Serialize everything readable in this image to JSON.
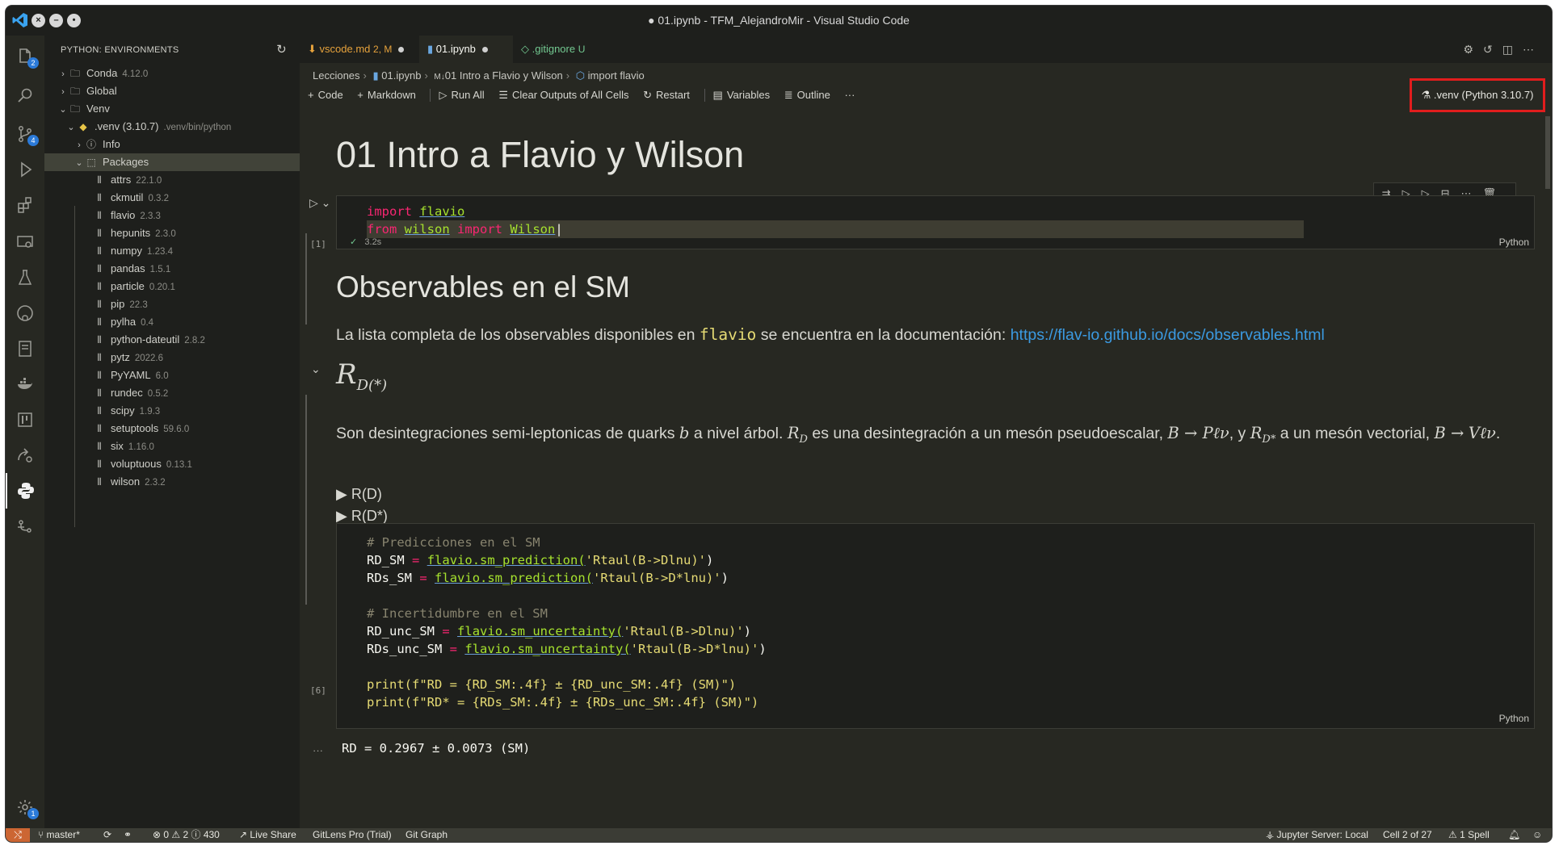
{
  "window": {
    "title": "● 01.ipynb - TFM_AlejandroMir - Visual Studio Code"
  },
  "activity_bar": {
    "explorer_badge": "2",
    "scm_badge": "4",
    "settings_badge": "1"
  },
  "sidebar": {
    "header": "PYTHON: ENVIRONMENTS",
    "groups": [
      {
        "label": "Conda",
        "sub": "4.12.0"
      },
      {
        "label": "Global",
        "sub": ""
      },
      {
        "label": "Venv",
        "sub": ""
      }
    ],
    "venv": {
      "label": ".venv (3.10.7)",
      "sub": ".venv/bin/python"
    },
    "info_label": "Info",
    "packages_label": "Packages",
    "packages": [
      {
        "name": "attrs",
        "version": "22.1.0"
      },
      {
        "name": "ckmutil",
        "version": "0.3.2"
      },
      {
        "name": "flavio",
        "version": "2.3.3"
      },
      {
        "name": "hepunits",
        "version": "2.3.0"
      },
      {
        "name": "numpy",
        "version": "1.23.4"
      },
      {
        "name": "pandas",
        "version": "1.5.1"
      },
      {
        "name": "particle",
        "version": "0.20.1"
      },
      {
        "name": "pip",
        "version": "22.3"
      },
      {
        "name": "pylha",
        "version": "0.4"
      },
      {
        "name": "python-dateutil",
        "version": "2.8.2"
      },
      {
        "name": "pytz",
        "version": "2022.6"
      },
      {
        "name": "PyYAML",
        "version": "6.0"
      },
      {
        "name": "rundec",
        "version": "0.5.2"
      },
      {
        "name": "scipy",
        "version": "1.9.3"
      },
      {
        "name": "setuptools",
        "version": "59.6.0"
      },
      {
        "name": "six",
        "version": "1.16.0"
      },
      {
        "name": "voluptuous",
        "version": "0.13.1"
      },
      {
        "name": "wilson",
        "version": "2.3.2"
      }
    ]
  },
  "tabs": [
    {
      "label": "vscode.md",
      "status": "2, M",
      "color": "#e6a23c"
    },
    {
      "label": "01.ipynb",
      "status": "",
      "color": "#f8f8f2"
    },
    {
      "label": ".gitignore",
      "status": "U",
      "color": "#73c991"
    }
  ],
  "breadcrumb": [
    "Lecciones",
    "01.ipynb",
    "01 Intro a Flavio y Wilson",
    "import flavio"
  ],
  "breadcrumb_prefix": "M↓",
  "toolbar": {
    "code": "Code",
    "markdown": "Markdown",
    "run_all": "Run All",
    "clear_outputs": "Clear Outputs of All Cells",
    "restart": "Restart",
    "variables": "Variables",
    "outline": "Outline",
    "more": "···"
  },
  "kernel": {
    "label": ".venv (Python 3.10.7)"
  },
  "notebook": {
    "title": "01 Intro a Flavio y Wilson",
    "cell1": {
      "exec_count": "[1]",
      "duration": "3.2s",
      "lang": "Python",
      "line1_kw": "import",
      "line1_mod": "flavio",
      "line2_kw1": "from",
      "line2_mod": "wilson",
      "line2_kw2": "import",
      "line2_cls": "Wilson"
    },
    "section_title": "Observables en el SM",
    "intro_text_1": "La lista completa de los observables disponibles en",
    "intro_code": "flavio",
    "intro_text_2": "se encuentra en la documentación:",
    "intro_link": "https://flav-io.github.io/docs/observables.html",
    "rd_heading": "R",
    "rd_heading_sub": "D(*)",
    "rd_text": {
      "p1": "Son desintegraciones semi-leptonicas de quarks",
      "b": "b",
      "p2": "a nivel árbol.",
      "rd": "R",
      "rd_sub": "D",
      "p3": "es una desintegración a un mesón pseudoescalar,",
      "decay1": "B → Pℓν",
      "p4": ", y",
      "rds": "R",
      "rds_sub": "D*",
      "p5": "a un mesón vectorial,",
      "decay2a": "B →",
      "decay2b": "Vℓν",
      "p6": "."
    },
    "details": [
      "R(D)",
      "R(D*)"
    ],
    "cell2": {
      "exec_count": "[6]",
      "lang": "Python",
      "comment1": "# Predicciones en el SM",
      "rd_sm_var": "RD_SM",
      "rd_sm_call": "flavio.sm_prediction(",
      "rd_sm_arg": "'Rtaul(B->Dlnu)'",
      "rds_sm_var": "RDs_SM",
      "rds_sm_arg": "'Rtaul(B->D*lnu)'",
      "comment2": "# Incertidumbre en el SM",
      "rd_unc_var": "RD_unc_SM",
      "unc_call": "flavio.sm_uncertainty(",
      "rds_unc_var": "RDs_unc_SM",
      "print1": "print(f\"RD = {RD_SM:.4f} ± {RD_unc_SM:.4f} (SM)\")",
      "print2": "print(f\"RD* = {RDs_SM:.4f} ± {RDs_unc_SM:.4f} (SM)\")"
    },
    "output_first_line": "RD = 0.2967 ± 0.0073 (SM)"
  },
  "statusbar": {
    "branch": "master*",
    "problems": "⊗ 0 ⚠ 2 ⓘ 430",
    "live_share": "Live Share",
    "gitlens": "GitLens Pro (Trial)",
    "git_graph": "Git Graph",
    "jupyter": "Jupyter Server: Local",
    "cell_pos": "Cell 2 of 27",
    "spell": "1 Spell"
  }
}
